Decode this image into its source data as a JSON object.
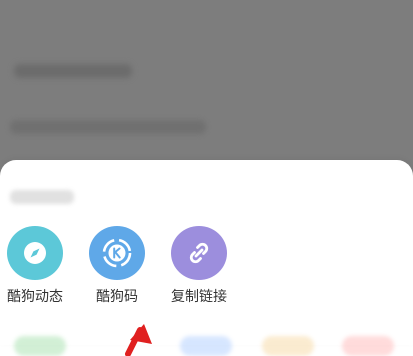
{
  "share_sheet": {
    "items": [
      {
        "label": "酷狗动态",
        "icon": "compass-icon",
        "color": "#5CC8D8"
      },
      {
        "label": "酷狗码",
        "icon": "kugou-code-icon",
        "color": "#5FA8E8"
      },
      {
        "label": "复制链接",
        "icon": "link-icon",
        "color": "#9C8EDD"
      }
    ]
  },
  "colors": {
    "overlay": "#7d7d7d",
    "arrow": "#e02020"
  }
}
